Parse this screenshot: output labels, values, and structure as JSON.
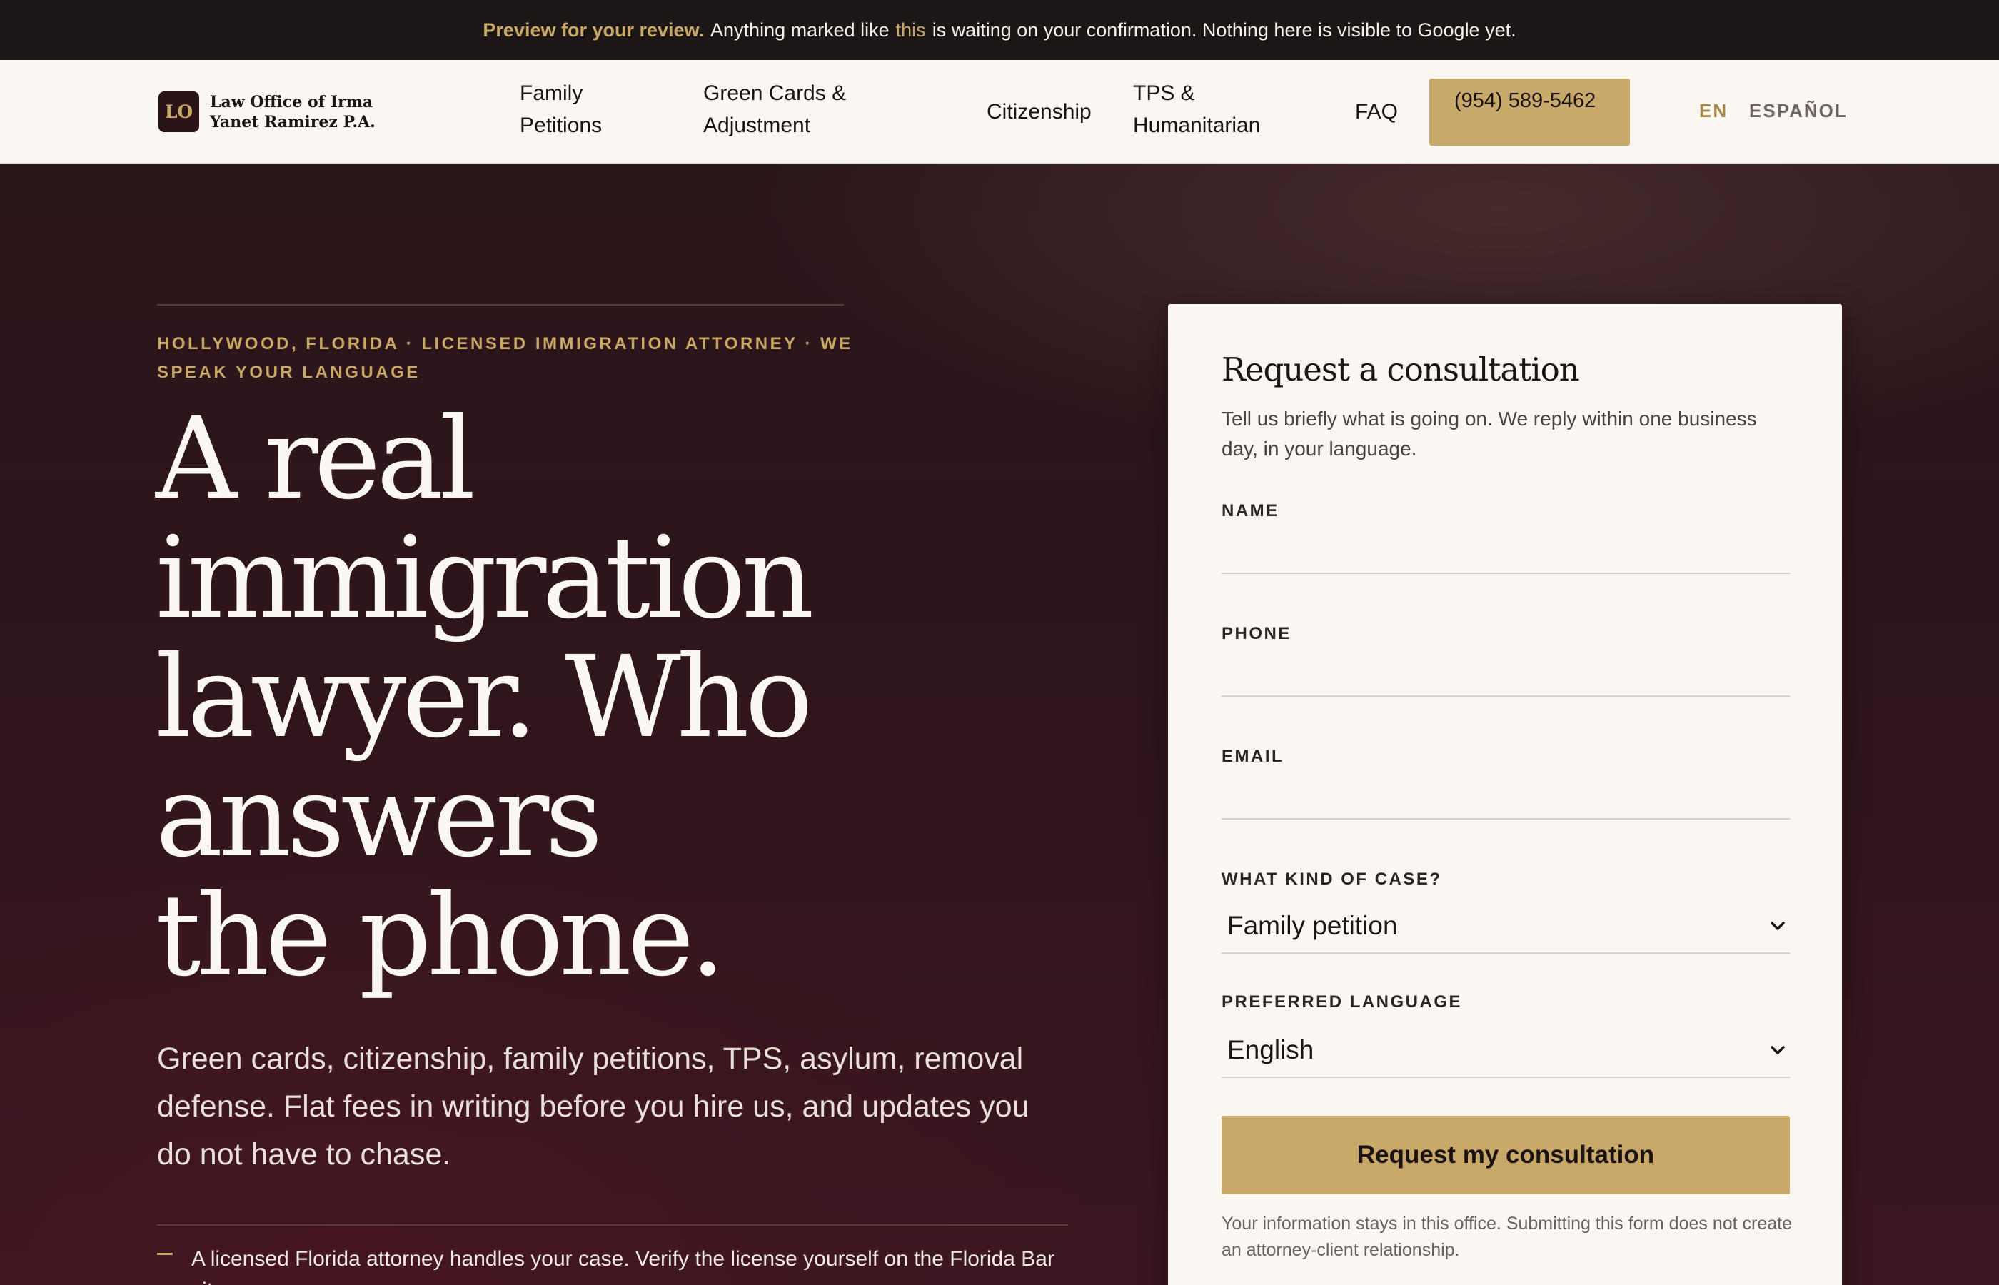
{
  "preview_bar": {
    "lead": "Preview for your review.",
    "text_before": "Anything marked like",
    "highlight": "this",
    "text_after": "is waiting on your confirmation. Nothing here is visible to Google yet."
  },
  "header": {
    "logo_initials": "LO",
    "firm_name": "Law Office of Irma Yanet Ramirez P.A.",
    "nav": [
      "Family Petitions",
      "Green Cards & Adjustment",
      "Citizenship",
      "TPS & Humanitarian",
      "FAQ"
    ],
    "phone": "(954) 589-5462",
    "lang_en": "EN",
    "lang_es": "ESPAÑOL"
  },
  "hero": {
    "eyebrow": "Hollywood, Florida · Licensed immigration attorney · We speak your language",
    "title_lines": [
      "A real",
      "immigration",
      "lawyer. Who",
      "answers",
      "the phone."
    ],
    "subtitle": "Green cards, citizenship, family petitions, TPS, asylum, removal defense. Flat fees in writing before you hire us, and updates you do not have to chase.",
    "proof_point": "A licensed Florida attorney handles your case. Verify the license yourself on the Florida Bar site."
  },
  "form": {
    "title": "Request a consultation",
    "intro": "Tell us briefly what is going on. We reply within one business day, in your language.",
    "name_label": "Name",
    "name_value": "",
    "phone_label": "Phone",
    "phone_value": "",
    "email_label": "Email",
    "email_value": "",
    "case_label": "What kind of case?",
    "case_value": "Family petition",
    "language_label": "Preferred language",
    "language_value": "English",
    "submit_label": "Request my consultation",
    "disclaimer": "Your information stays in this office. Submitting this form does not create an attorney-client relationship."
  },
  "colors": {
    "accent_gold": "#c8a96a",
    "hero_background": "#2e161c",
    "card_background": "#faf6f2",
    "preview_bar": "#1c1617"
  }
}
